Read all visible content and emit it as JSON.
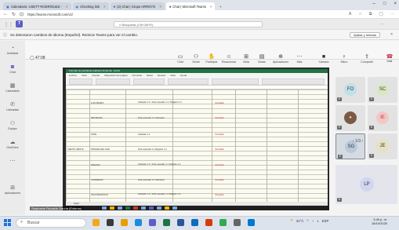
{
  "browser": {
    "tabs": [
      {
        "label": "Calendario: USETT RODRÍGUEZ -",
        "active": false
      },
      {
        "label": "Checking link",
        "active": false
      },
      {
        "label": "(2) Chat | Grupo ARROYO",
        "active": false
      },
      {
        "label": "Chat | Microsoft Teams",
        "active": true
      }
    ],
    "url": "https://teams.microsoft.com/v2/"
  },
  "teams": {
    "search_placeholder": "Búsqueda (Ctrl+Alt+E)",
    "notice": "Se detectaron cambios de idioma (Español). Reinicie Teams para ver el cambio.",
    "notice_button": "Aplicar y reiniciar",
    "rail": [
      "Actividad",
      "Chat",
      "Calendario",
      "Llamadas",
      "Equipo",
      "OneDrive",
      "Aplicaciones"
    ],
    "meeting": {
      "timer": "47:08",
      "controls": [
        "Chat",
        "Gente",
        "Participar",
        "Reaccionar",
        "Vista",
        "Notas",
        "Aplicaciones",
        "Más",
        "Cámara",
        "Micro",
        "Compartir"
      ],
      "leave": "Salir"
    },
    "presenter": "Stephanie Recalde García (Externo)",
    "participants": [
      {
        "initials": "FO",
        "badge": "E"
      },
      {
        "initials": "SC",
        "badge": "E"
      },
      {
        "initials": "",
        "badge": "E",
        "photo": true
      },
      {
        "initials": "IE",
        "badge": "E"
      },
      {
        "initials": "SG",
        "badge": "E",
        "selected": true
      },
      {
        "initials": "JE",
        "badge": "E"
      },
      {
        "initials": "LP",
        "badge": "E"
      }
    ],
    "pager": "1/3"
  },
  "excel": {
    "title": "Formato de pendiente auditoría Finanzas - Excel",
    "menu": [
      "Archivo",
      "Inicio",
      "Insertar",
      "Disposición de página",
      "Fórmulas",
      "Datos",
      "Revisar",
      "Vista",
      "Ayuda"
    ],
    "sheet": "Hoja1",
    "rows": [
      {
        "center": "",
        "office": "LUIS PRADO",
        "indicator": "Indicador 1.1 / Folio anexado 1.1 / Registro 1.2",
        "status": "Vinculado"
      },
      {
        "center": "",
        "office": "PANTANOS",
        "indicator": "Folio anexado 1.1 Ubicación",
        "status": "Vinculado"
      },
      {
        "center": "",
        "office": "ANTE",
        "indicator": "Indicador 1.1",
        "status": "Vinculado"
      },
      {
        "center": "CIENTO VEINTE",
        "office": "PRIVADA DEL SUR",
        "indicator": "Folio anexado 1.1 Registro 1.2",
        "status": "Vinculado"
      },
      {
        "center": "",
        "office": "PARAISO",
        "indicator": "Indicador 1.2 / Folio anexado 1.1 Registro 1.2",
        "status": "Vinculado"
      },
      {
        "center": "",
        "office": "CONSENGO",
        "indicator": "Folio anexado 1.1 Ubicación",
        "status": "Vinculado"
      },
      {
        "center": "",
        "office": "SAN FRANCISCO",
        "indicator": "Indicador 1.1 / Folio anexado 1.1 Registro 1.2",
        "status": "Vinculado"
      }
    ]
  },
  "windows": {
    "search": "Buscar",
    "weather": "31°C",
    "language": "ESP",
    "time": "3:40 p. m.",
    "date": "18/10/2025"
  }
}
